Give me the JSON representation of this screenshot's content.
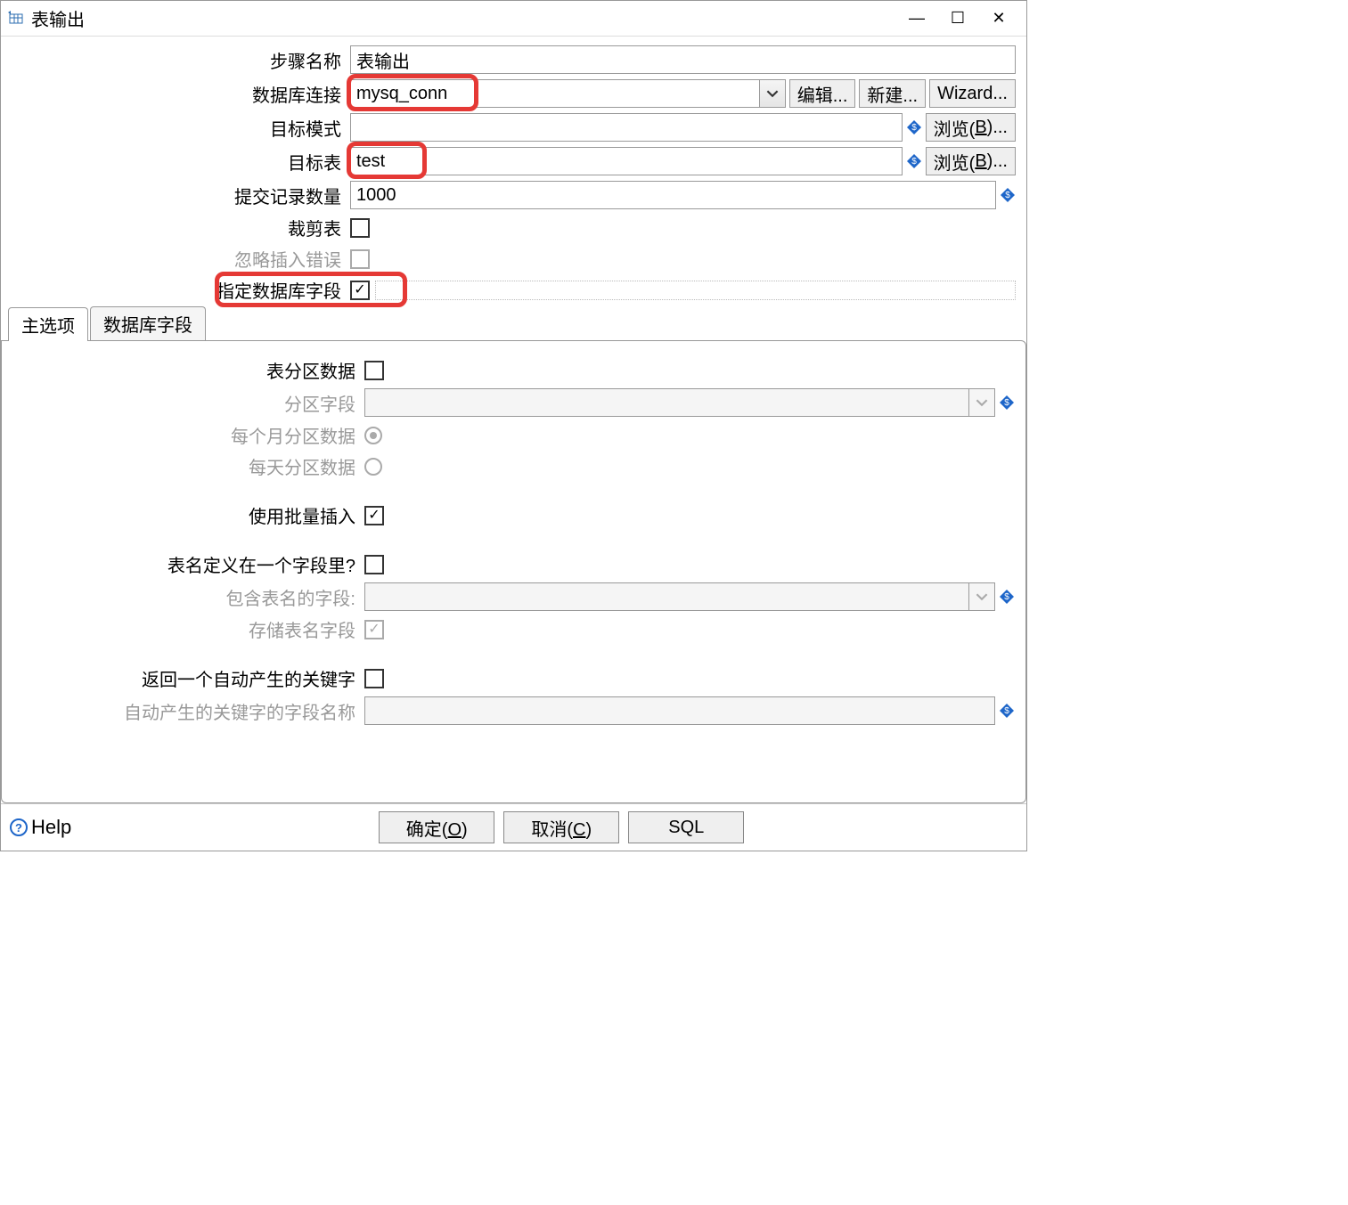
{
  "title": "表输出",
  "labels": {
    "step_name": "步骤名称",
    "db_conn": "数据库连接",
    "target_schema": "目标模式",
    "target_table": "目标表",
    "commit_size": "提交记录数量",
    "truncate": "裁剪表",
    "ignore_insert_err": "忽略插入错误",
    "specify_db_fields": "指定数据库字段",
    "partition_data": "表分区数据",
    "partition_field": "分区字段",
    "partition_monthly": "每个月分区数据",
    "partition_daily": "每天分区数据",
    "use_batch": "使用批量插入",
    "table_in_field_q": "表名定义在一个字段里?",
    "field_with_table": "包含表名的字段:",
    "store_table_field": "存储表名字段",
    "return_auto_key": "返回一个自动产生的关键字",
    "auto_key_field": "自动产生的关键字的字段名称"
  },
  "values": {
    "step_name": "表输出",
    "db_conn": "mysq_conn",
    "target_schema": "",
    "target_table": "test",
    "commit_size": "1000",
    "truncate": false,
    "ignore_insert_err": false,
    "specify_db_fields": true,
    "partition_data": false,
    "partition_field": "",
    "partition_mode": "monthly",
    "use_batch": true,
    "table_in_field": false,
    "field_with_table": "",
    "store_table_field": true,
    "return_auto_key": false,
    "auto_key_field": ""
  },
  "buttons": {
    "edit": "编辑...",
    "new": "新建...",
    "wizard": "Wizard...",
    "browse_b": "浏览(B)...",
    "ok": "确定(O)",
    "cancel": "取消(C)",
    "sql": "SQL",
    "help": "Help"
  },
  "tabs": {
    "main": "主选项",
    "db_fields": "数据库字段"
  }
}
